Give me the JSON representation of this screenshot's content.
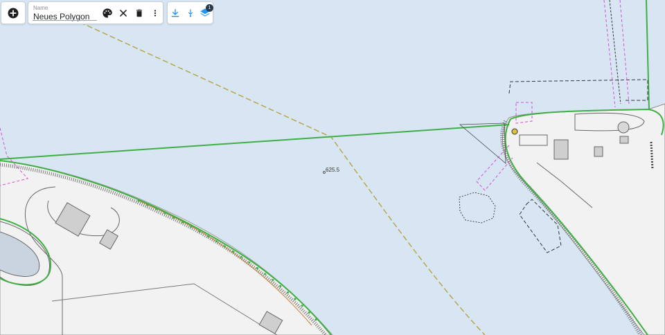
{
  "toolbar": {
    "add_icon": "plus-circle-icon",
    "name_label": "Name",
    "name_value": "Neues Polygon",
    "actions": [
      "palette-icon",
      "close-icon",
      "delete-icon",
      "more-vert-icon"
    ],
    "layer_actions": [
      "download-icon",
      "download-point-icon",
      "layers-icon"
    ],
    "layer_badge": "1",
    "accent_color": "#2196f3"
  },
  "map": {
    "elevation_label": "625.5",
    "colors": {
      "water": "#d8e6f4",
      "land": "#f2f2f2",
      "polygon_line": "#3fae44",
      "dashed_route": "#b8a64a",
      "boundary_magenta": "#d64fd6"
    }
  }
}
